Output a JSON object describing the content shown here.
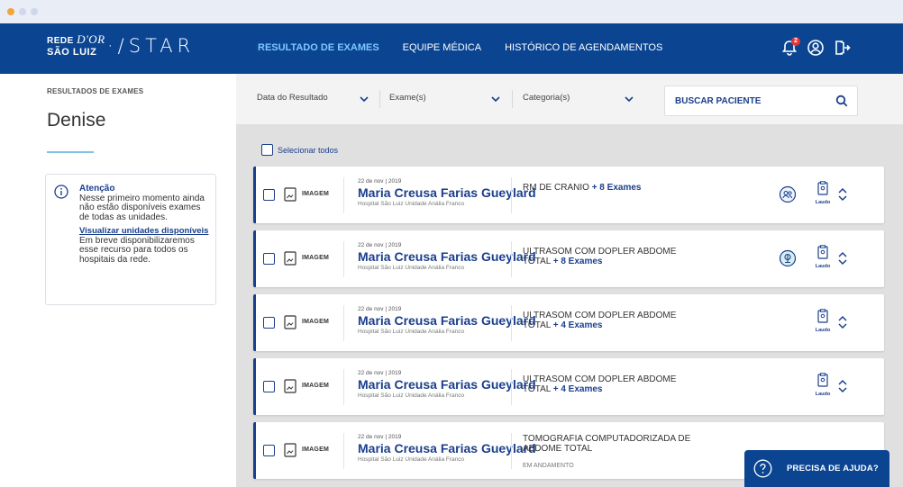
{
  "brand": {
    "line1": "REDE",
    "line1_script": "D'OR",
    "line2": "SÃO LUIZ",
    "product": "STAR",
    "primary_color": "#0b4592",
    "accent_color": "#1a3f8c"
  },
  "nav": {
    "items": [
      {
        "label": "RESULTADO DE EXAMES",
        "active": true
      },
      {
        "label": "EQUIPE MÉDICA",
        "active": false
      },
      {
        "label": "HISTÓRICO DE AGENDAMENTOS",
        "active": false
      }
    ],
    "notification_count": "2",
    "icons": [
      "bell-icon",
      "user-icon",
      "logout-icon"
    ]
  },
  "sidebar": {
    "breadcrumb": "RESULTADOS DE EXAMES",
    "patient_name": "Denise",
    "alert": {
      "title": "Atenção",
      "text1": "Nesse primeiro momento ainda não estão disponíveis exames de todas as unidades.",
      "link": "Visualizar unidades disponíveis",
      "text2": "Em breve disponibilizaremos esse recurso para todos os hospitais da rede."
    }
  },
  "filters": {
    "date": "Data do Resultado",
    "exams": "Exame(s)",
    "category": "Categoria(s)",
    "search_label": "BUSCAR PACIENTE"
  },
  "list": {
    "select_all": "Selecionar todos",
    "cards": [
      {
        "type": "IMAGEM",
        "date": "22 de nov | 2019",
        "name": "Maria Creusa Farias Gueylard",
        "hospital": "Hospital São Luiz Unidade Anália Franco",
        "exam": "RM DE CRANIO",
        "more": "+ 8 Exames",
        "status": "",
        "circle_icon": "team-icon",
        "laudo": "Laudo"
      },
      {
        "type": "IMAGEM",
        "date": "22 de nov | 2019",
        "name": "Maria Creusa Farias Gueylard",
        "hospital": "Hospital São Luiz Unidade Anália Franco",
        "exam": "ULTRASOM COM DOPLER ABDOME TOTAL",
        "more": "+ 8 Exames",
        "status": "",
        "circle_icon": "share-icon",
        "laudo": "Laudo"
      },
      {
        "type": "IMAGEM",
        "date": "22 de nov | 2019",
        "name": "Maria Creusa Farias Gueylard",
        "hospital": "Hospital São Luiz Unidade Anália Franco",
        "exam": "ULTRASOM COM DOPLER ABDOME TOTAL",
        "more": "+ 4 Exames",
        "status": "",
        "circle_icon": "",
        "laudo": "Laudo"
      },
      {
        "type": "IMAGEM",
        "date": "22 de nov | 2019",
        "name": "Maria Creusa Farias Gueylard",
        "hospital": "Hospital São Luiz Unidade Anália Franco",
        "exam": "ULTRASOM COM DOPLER ABDOME TOTAL",
        "more": "+ 4 Exames",
        "status": "",
        "circle_icon": "",
        "laudo": "Laudo"
      },
      {
        "type": "IMAGEM",
        "date": "22 de nov | 2019",
        "name": "Maria Creusa Farias Gueylard",
        "hospital": "Hospital São Luiz Unidade Anália Franco",
        "exam": "TOMOGRAFIA COMPUTADORIZADA DE ABDOME TOTAL",
        "more": "",
        "status": "EM ANDAMENTO",
        "circle_icon": "",
        "laudo": ""
      }
    ]
  },
  "help": {
    "label": "PRECISA DE AJUDA?"
  }
}
